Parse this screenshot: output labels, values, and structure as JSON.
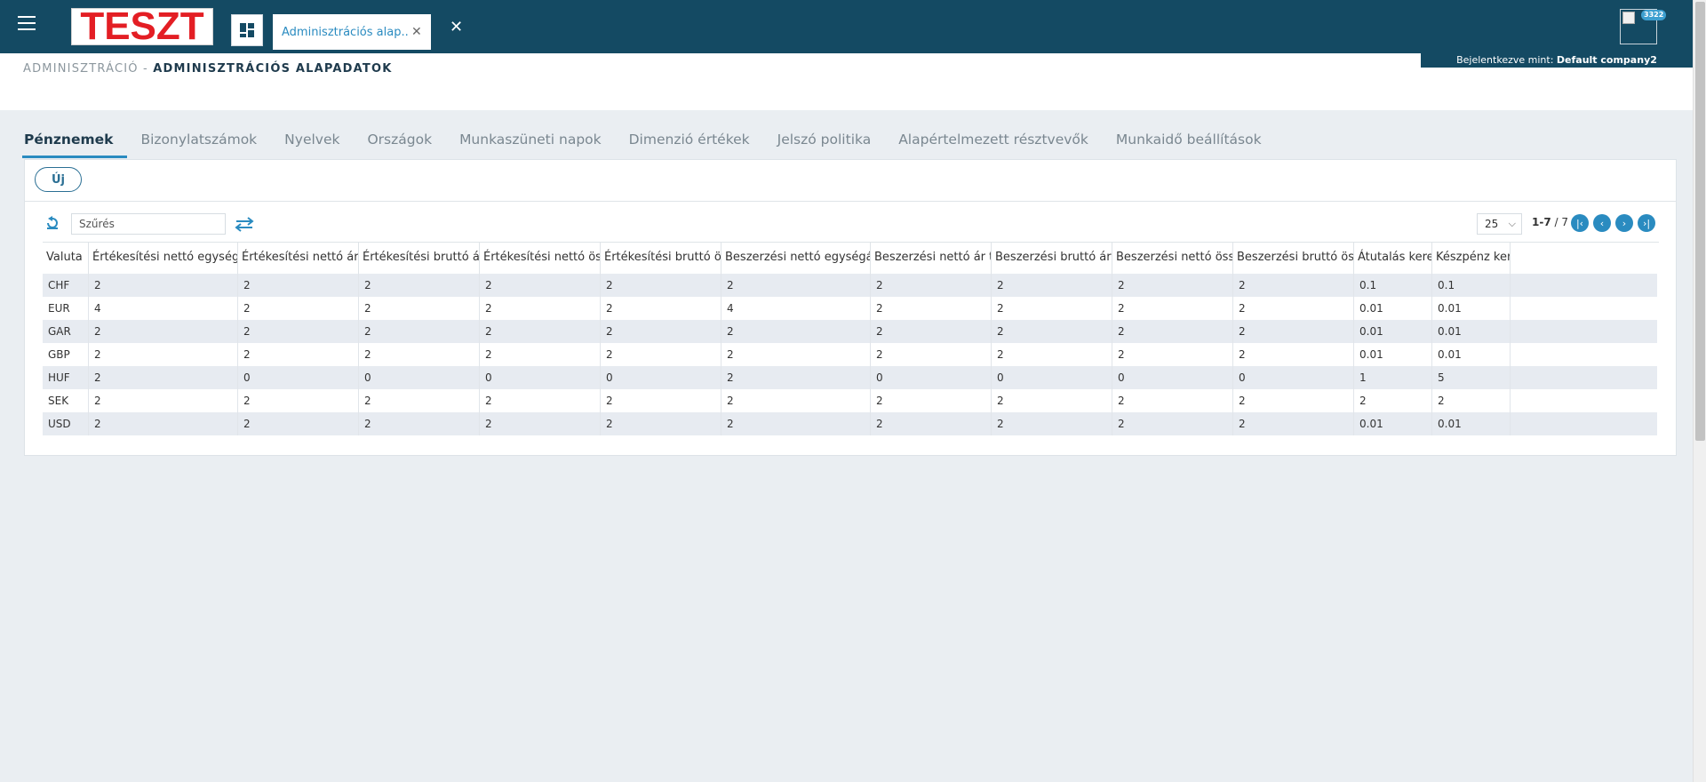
{
  "header": {
    "logo_text": "TESZT",
    "app_tab_label": "Adminisztrációs alap...",
    "user_badge": "3322",
    "login_prefix": "Bejelentkezve mint:",
    "login_user": "Default company2"
  },
  "breadcrumb": {
    "parent": "ADMINISZTRÁCIÓ -",
    "current": "ADMINISZTRÁCIÓS ALAPADATOK"
  },
  "tabs": [
    {
      "label": "Pénznemek",
      "active": true
    },
    {
      "label": "Bizonylatszámok",
      "active": false
    },
    {
      "label": "Nyelvek",
      "active": false
    },
    {
      "label": "Országok",
      "active": false
    },
    {
      "label": "Munkaszüneti napok",
      "active": false
    },
    {
      "label": "Dimenzió értékek",
      "active": false
    },
    {
      "label": "Jelszó politika",
      "active": false
    },
    {
      "label": "Alapértelmezett résztvevők",
      "active": false
    },
    {
      "label": "Munkaidő beállítások",
      "active": false
    }
  ],
  "toolbar": {
    "new_label": "Új",
    "filter_placeholder": "Szűrés",
    "page_size": "25",
    "page_range": "1-7",
    "page_total": "/ 7"
  },
  "table": {
    "columns": [
      "Valuta",
      "Értékesítési nettó egységár",
      "Értékesítési nettó ár",
      "Értékesítési bruttó ár",
      "Értékesítési nettó összeg",
      "Értékesítési bruttó összeg",
      "Beszerzési nettó egységár",
      "Beszerzési nettó ár t",
      "Beszerzési bruttó ár",
      "Beszerzési nettó összeg",
      "Beszerzési bruttó összeg",
      "Átutalás kerekítés",
      "Készpénz kerekítés"
    ],
    "rows": [
      [
        "CHF",
        "2",
        "2",
        "2",
        "2",
        "2",
        "2",
        "2",
        "2",
        "2",
        "2",
        "0.1",
        "0.1"
      ],
      [
        "EUR",
        "4",
        "2",
        "2",
        "2",
        "2",
        "4",
        "2",
        "2",
        "2",
        "2",
        "0.01",
        "0.01"
      ],
      [
        "GAR",
        "2",
        "2",
        "2",
        "2",
        "2",
        "2",
        "2",
        "2",
        "2",
        "2",
        "0.01",
        "0.01"
      ],
      [
        "GBP",
        "2",
        "2",
        "2",
        "2",
        "2",
        "2",
        "2",
        "2",
        "2",
        "2",
        "0.01",
        "0.01"
      ],
      [
        "HUF",
        "2",
        "0",
        "0",
        "0",
        "0",
        "2",
        "0",
        "0",
        "0",
        "0",
        "1",
        "5"
      ],
      [
        "SEK",
        "2",
        "2",
        "2",
        "2",
        "2",
        "2",
        "2",
        "2",
        "2",
        "2",
        "2",
        "2"
      ],
      [
        "USD",
        "2",
        "2",
        "2",
        "2",
        "2",
        "2",
        "2",
        "2",
        "2",
        "2",
        "0.01",
        "0.01"
      ]
    ]
  }
}
